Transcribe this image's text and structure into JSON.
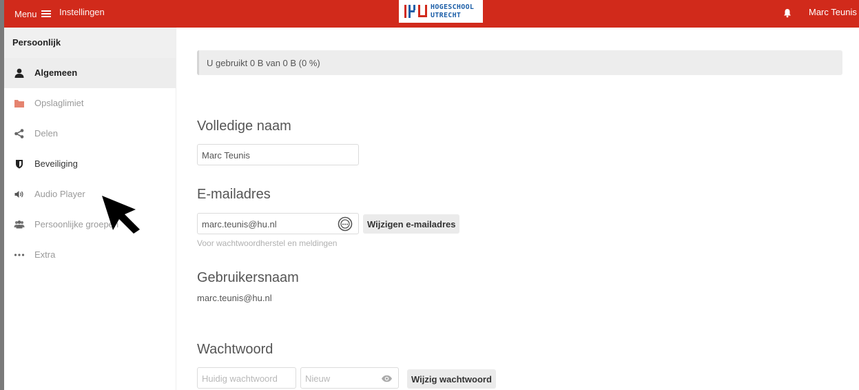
{
  "header": {
    "menu_label": "Menu",
    "settings_label": "Instellingen",
    "logo_line1": "HOGESCHOOL",
    "logo_line2": "UTRECHT",
    "user_name": "Marc Teunis",
    "brand_color": "#d12a1b",
    "logo_color": "#1d5fa8"
  },
  "sidebar": {
    "heading": "Persoonlijk",
    "items": [
      {
        "label": "Algemeen",
        "icon": "user-icon",
        "active": true
      },
      {
        "label": "Opslaglimiet",
        "icon": "folder-icon"
      },
      {
        "label": "Delen",
        "icon": "share-icon"
      },
      {
        "label": "Beveiliging",
        "icon": "shield-icon"
      },
      {
        "label": "Audio Player",
        "icon": "speaker-icon"
      },
      {
        "label": "Persoonlijke groepen",
        "icon": "users-icon"
      },
      {
        "label": "Extra",
        "icon": "more-icon"
      }
    ]
  },
  "main": {
    "quota_text": "U gebruikt 0 B van 0 B (0 %)",
    "fullname": {
      "title": "Volledige naam",
      "value": "Marc Teunis"
    },
    "email": {
      "title": "E-mailadres",
      "value": "marc.teunis@hu.nl",
      "button_label": "Wijzigen e-mailadres",
      "hint": "Voor wachtwoordherstel en meldingen"
    },
    "username": {
      "title": "Gebruikersnaam",
      "value": "marc.teunis@hu.nl"
    },
    "password": {
      "title": "Wachtwoord",
      "current_placeholder": "Huidig wachtwoord",
      "new_placeholder": "Nieuw",
      "button_label": "Wijzig wachtwoord"
    }
  }
}
